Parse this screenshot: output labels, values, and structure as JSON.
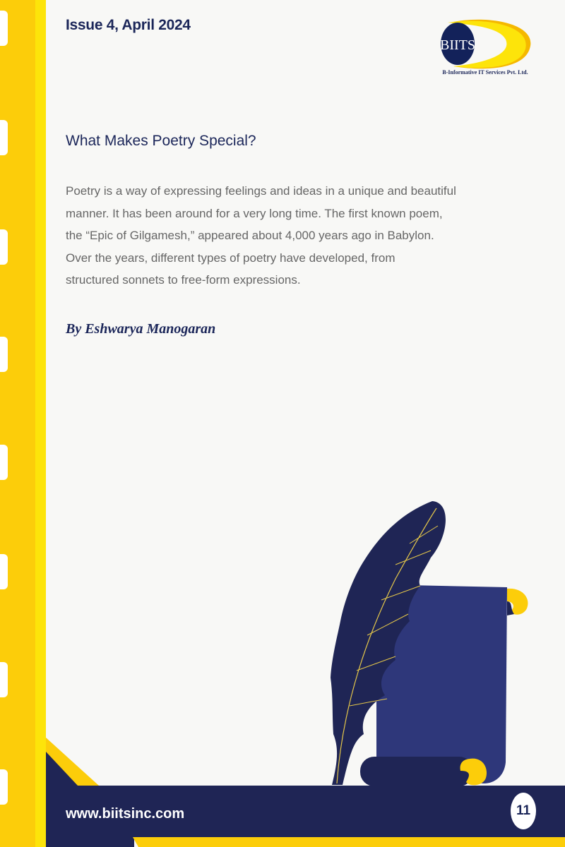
{
  "header": {
    "issue": "Issue 4, April 2024"
  },
  "logo": {
    "text": "BIITS",
    "company": "B-Informative IT Services Pvt. Ltd."
  },
  "article": {
    "title": "What Makes Poetry Special?",
    "body_lines": [
      "Poetry is a way of expressing feelings and ideas in a unique and beautiful",
      "manner. It has been around for a very long time. The first known poem,",
      "the “Epic of Gilgamesh,” appeared about 4,000 years ago in Babylon.",
      "Over the years, different types of poetry have developed, from",
      "structured sonnets to free-form expressions."
    ],
    "byline": "By Eshwarya Manogaran"
  },
  "footer": {
    "website": "www.biitsinc.com",
    "page_number": "11"
  },
  "colors": {
    "navy": "#1f2555",
    "yellow": "#fccd0a",
    "scroll": "#2e377a"
  }
}
